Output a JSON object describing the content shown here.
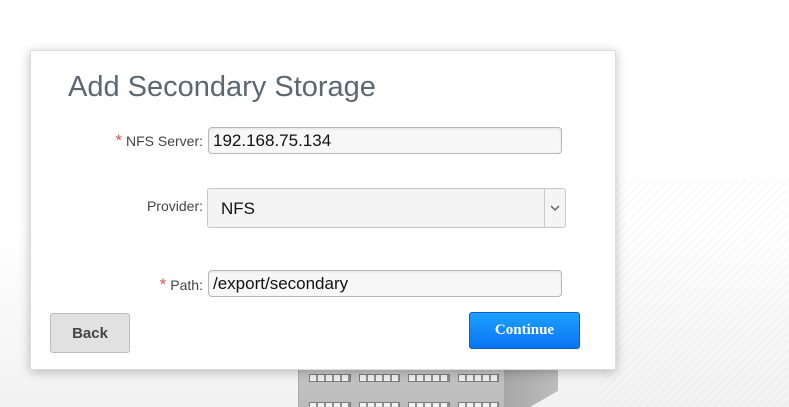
{
  "dialog": {
    "title": "Add Secondary Storage"
  },
  "form": {
    "nfs_server": {
      "required_mark": "*",
      "label": "NFS Server:",
      "value": "192.168.75.134"
    },
    "provider": {
      "label": "Provider:",
      "selected": "NFS"
    },
    "path": {
      "required_mark": "*",
      "label": "Path:",
      "value": "/export/secondary"
    }
  },
  "actions": {
    "back_label": "Back",
    "continue_label": "Continue"
  },
  "icons": {
    "select_arrow": "chevron-down-icon"
  },
  "colors": {
    "primary_button": "#0a74f2",
    "required_mark": "#d9534f",
    "title": "#5b6771"
  }
}
